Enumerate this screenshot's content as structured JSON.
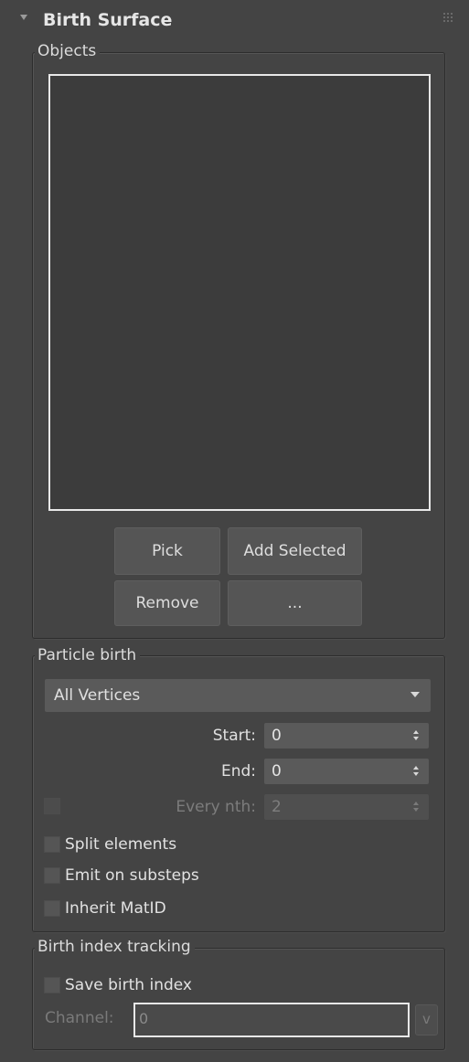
{
  "rollout": {
    "title": "Birth Surface"
  },
  "objects_group": {
    "label": "Objects",
    "buttons": {
      "pick": "Pick",
      "add_selected": "Add Selected",
      "remove": "Remove",
      "more": "..."
    }
  },
  "particle_birth": {
    "label": "Particle birth",
    "mode_dropdown": {
      "selected": "All Vertices"
    },
    "start": {
      "label": "Start:",
      "value": "0"
    },
    "end": {
      "label": "End:",
      "value": "0"
    },
    "every_nth": {
      "label": "Every nth:",
      "value": "2",
      "enabled": false,
      "checked": false
    },
    "options": [
      {
        "label": "Split elements",
        "checked": false
      },
      {
        "label": "Emit on substeps",
        "checked": false
      },
      {
        "label": "Inherit MatID",
        "checked": false
      }
    ]
  },
  "birth_index_tracking": {
    "label": "Birth index tracking",
    "save_birth_index": {
      "label": "Save birth index",
      "checked": false
    },
    "channel": {
      "label": "Channel:",
      "value": "0",
      "enabled": false
    },
    "channel_button": "v"
  }
}
